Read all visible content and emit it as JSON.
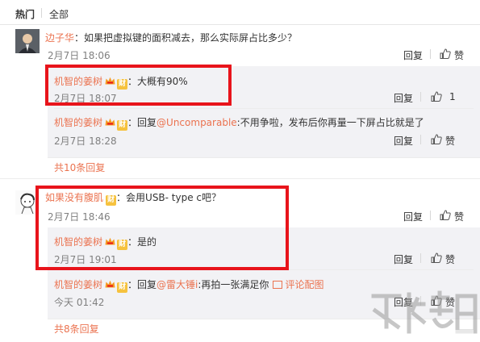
{
  "tabs": {
    "hot": "热门",
    "all": "全部"
  },
  "actions": {
    "reply": "回复",
    "like": "赞"
  },
  "comments": [
    {
      "user": "边子华",
      "text": "如果把虚拟键的面积减去，那么实际屏占比多少？",
      "time": "2月7日 18:06",
      "replies": [
        {
          "user": "机智的姜树",
          "text": "大概有90%",
          "time": "2月7日 18:07",
          "likes": "1"
        },
        {
          "user": "机智的姜树",
          "reply_prefix": "回复",
          "mention": "@Uncomparable",
          "text": ":不用争啦，发布后你再量一下屏占比就是了",
          "time": "2月7日 18:28"
        }
      ],
      "more": "共10条回复"
    },
    {
      "user": "如果没有腹肌",
      "text": "会用USB- type c吧？",
      "time": "2月7日 18:46",
      "replies": [
        {
          "user": "机智的姜树",
          "text": "是的",
          "time": "2月7日 19:01"
        },
        {
          "user": "机智的姜树",
          "reply_prefix": "回复",
          "mention": "@雷大锤i",
          "text": ":再拍一张满足你",
          "image_link": "评论配图",
          "time": "今天 01:42"
        }
      ],
      "more": "共8条回复"
    }
  ],
  "badge": {
    "cai": "财"
  },
  "colors": {
    "accent": "#eb7350",
    "highlight": "#e8141b",
    "reply_bg": "#f2f2f5"
  }
}
